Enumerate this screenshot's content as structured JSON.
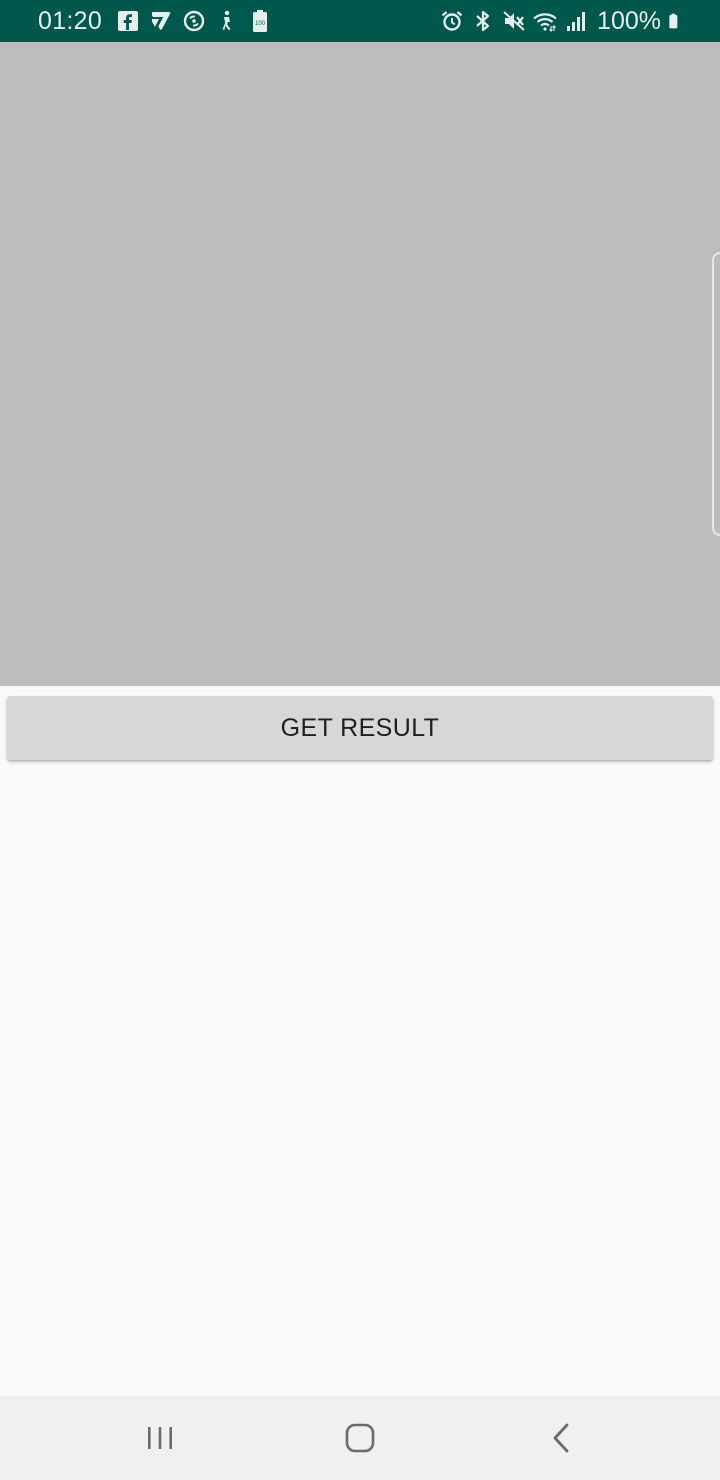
{
  "status_bar": {
    "time": "01:20",
    "battery_percent": "100%",
    "background_color": "#00574b",
    "notification_icons": [
      "facebook-icon",
      "app-7-icon",
      "sync-icon",
      "accessibility-icon",
      "battery-saver-icon"
    ],
    "system_icons": [
      "alarm-icon",
      "bluetooth-icon",
      "mute-icon",
      "wifi-icon",
      "signal-icon",
      "battery-icon"
    ]
  },
  "preview": {
    "background_color": "#bdbdbd"
  },
  "main": {
    "get_result_label": "GET RESULT"
  },
  "nav_bar": {
    "buttons": [
      "recent-apps",
      "home",
      "back"
    ]
  }
}
